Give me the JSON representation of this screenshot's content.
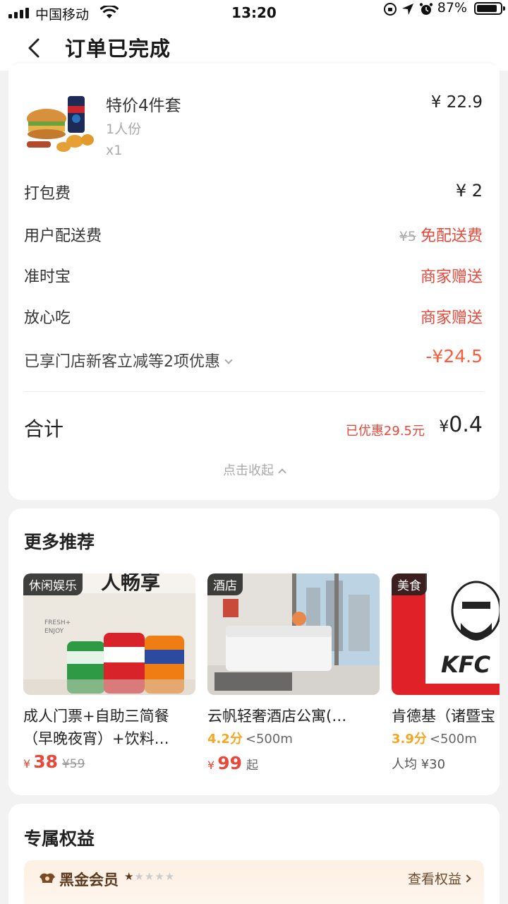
{
  "status_bar": {
    "carrier": "中国移动",
    "time": "13:20",
    "battery": "87%"
  },
  "nav": {
    "title": "订单已完成"
  },
  "order": {
    "product": {
      "name": "特价4件套",
      "spec": "1人份",
      "qty": "x1",
      "price": "¥ 22.9"
    },
    "packing": {
      "label": "打包费",
      "value": "¥ 2"
    },
    "delivery": {
      "label": "用户配送费",
      "original": "¥5",
      "value": "免配送费"
    },
    "ontime": {
      "label": "准时宝",
      "value": "商家赠送"
    },
    "safe": {
      "label": "放心吃",
      "value": "商家赠送"
    },
    "discount": {
      "label": "已享门店新客立减等2项优惠",
      "value": "-¥24.5"
    },
    "total": {
      "label": "合计",
      "saved": "已优惠29.5元",
      "currency": "¥",
      "amount": "0.4"
    },
    "collapse": "点击收起"
  },
  "recommend": {
    "title": "更多推荐",
    "items": [
      {
        "tag": "休闲娱乐",
        "title1": "成人门票+自助三简餐",
        "title2": "（早晚夜宵）+饮料…",
        "currency": "¥",
        "price": "38",
        "original": "¥59"
      },
      {
        "tag": "酒店",
        "title1": "云帆轻奢酒店公寓(…",
        "rating": "4.2分",
        "distance": "<500m",
        "currency": "¥",
        "price": "99",
        "suffix": "起"
      },
      {
        "tag": "美食",
        "title1": "肯德基（诸暨宝",
        "rating": "3.9分",
        "distance": "<500m",
        "avg": "人均 ¥30",
        "image_text": "KFC"
      }
    ]
  },
  "benefits": {
    "title": "专属权益",
    "member": {
      "name": "黑金会员",
      "stars": "★★★★★",
      "filled_stars": 1,
      "link": "查看权益"
    }
  },
  "colors": {
    "accent_red": "#e8483a",
    "rating_orange": "#f5a623",
    "member_brown": "#5b3a1f"
  }
}
